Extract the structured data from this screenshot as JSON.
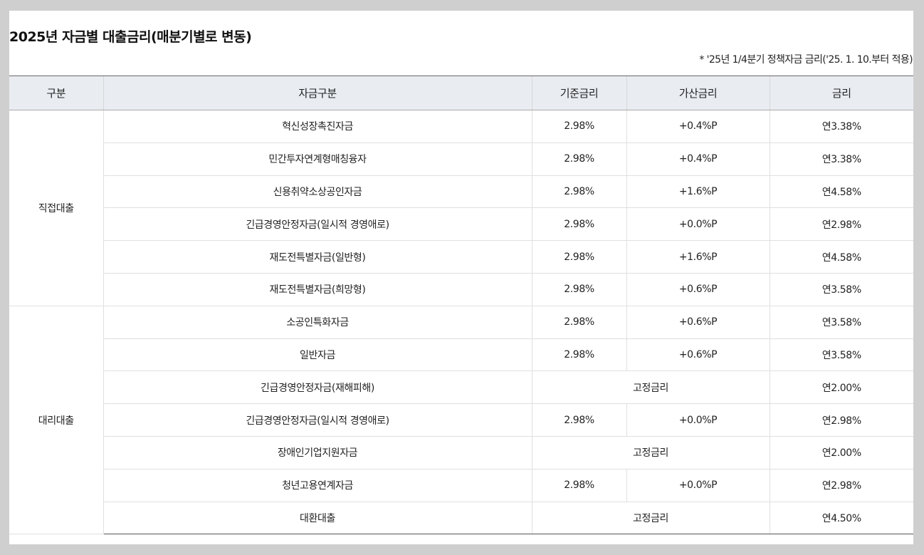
{
  "title": "2025년 자금별 대출금리(매분기별로 변동)",
  "note": "* '25년 1/4분기 정책자금 금리('25. 1. 10.부터 적용)",
  "headers": [
    "구분",
    "자금구분",
    "기준금리",
    "가산금리",
    "금리"
  ],
  "groups": [
    {
      "label": "직접대출",
      "rows": [
        {
          "fund": "혁신성장촉진자금",
          "base": "2.98%",
          "add": "+0.4%P",
          "rate": "연3.38%"
        },
        {
          "fund": "민간투자연계형매칭융자",
          "base": "2.98%",
          "add": "+0.4%P",
          "rate": "연3.38%"
        },
        {
          "fund": "신용취약소상공인자금",
          "base": "2.98%",
          "add": "+1.6%P",
          "rate": "연4.58%"
        },
        {
          "fund": "긴급경영안정자금(일시적 경영애로)",
          "base": "2.98%",
          "add": "+0.0%P",
          "rate": "연2.98%"
        },
        {
          "fund": "재도전특별자금(일반형)",
          "base": "2.98%",
          "add": "+1.6%P",
          "rate": "연4.58%"
        },
        {
          "fund": "재도전특별자금(희망형)",
          "base": "2.98%",
          "add": "+0.6%P",
          "rate": "연3.58%"
        }
      ]
    },
    {
      "label": "대리대출",
      "rows": [
        {
          "fund": "소공인특화자금",
          "base": "2.98%",
          "add": "+0.6%P",
          "rate": "연3.58%"
        },
        {
          "fund": "일반자금",
          "base": "2.98%",
          "add": "+0.6%P",
          "rate": "연3.58%"
        },
        {
          "fund": "긴급경영안정자금(재해피해)",
          "fixed": "고정금리",
          "rate": "연2.00%"
        },
        {
          "fund": "긴급경영안정자금(일시적 경영애로)",
          "base": "2.98%",
          "add": "+0.0%P",
          "rate": "연2.98%"
        },
        {
          "fund": "장애인기업지원자금",
          "fixed": "고정금리",
          "rate": "연2.00%"
        },
        {
          "fund": "청년고용연계자금",
          "base": "2.98%",
          "add": "+0.0%P",
          "rate": "연2.98%"
        },
        {
          "fund": "대환대출",
          "fixed": "고정금리",
          "rate": "연4.50%"
        }
      ]
    }
  ]
}
